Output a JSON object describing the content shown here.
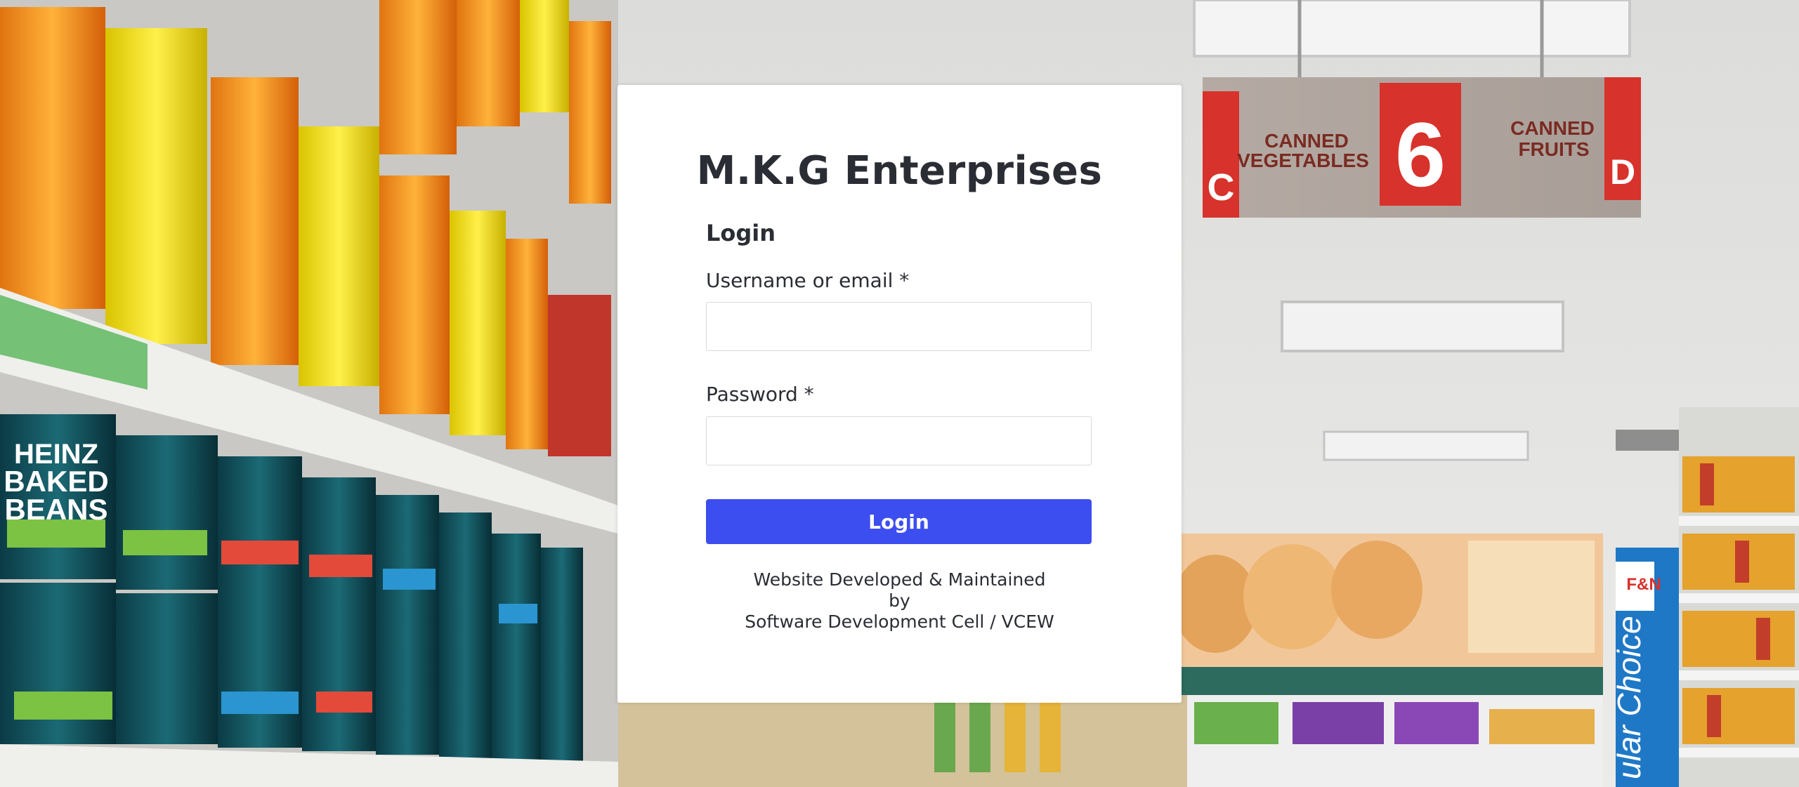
{
  "brand": {
    "title": "M.K.G Enterprises"
  },
  "form": {
    "title": "Login",
    "username_label": "Username or email *",
    "username_value": "",
    "password_label": "Password *",
    "password_value": "",
    "submit_label": "Login"
  },
  "footer": {
    "line1": "Website Developed & Maintained",
    "line2": "by",
    "line3": "Software Development Cell / VCEW"
  },
  "background": {
    "sign_left_letter": "C",
    "sign_left_text_1": "CANNED",
    "sign_left_text_2": "VEGETABLES",
    "sign_number": "6",
    "sign_right_text_1": "CANNED",
    "sign_right_text_2": "FRUITS",
    "sign_right_letter": "D",
    "can_brand": "HEINZ",
    "can_label_1": "BAKED",
    "can_label_2": "BEANS",
    "banner_text": "ular Choice",
    "banner_logo": "F&N"
  },
  "colors": {
    "accent": "#3d4ef0",
    "text": "#2a2d34",
    "sign_red": "#d7322b"
  }
}
